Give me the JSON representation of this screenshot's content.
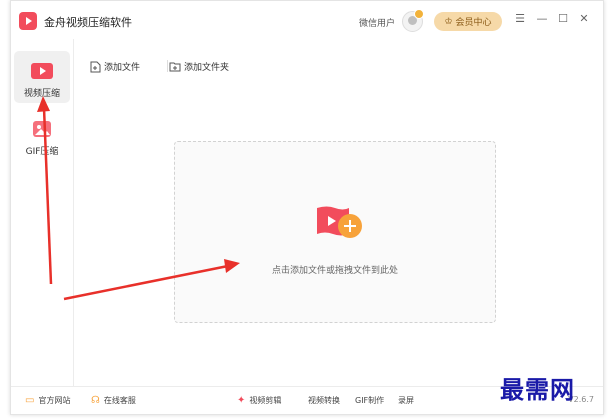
{
  "app": {
    "title": "金舟视频压缩软件"
  },
  "header": {
    "user_name": "微信用户",
    "vip_label": "会员中心"
  },
  "window_controls": {
    "menu": "☰",
    "minimize": "—",
    "maximize": "☐",
    "close": "✕"
  },
  "sidebar": {
    "items": [
      {
        "label": "视频压缩",
        "active": true
      },
      {
        "label": "GIF压缩",
        "active": false
      }
    ]
  },
  "toolbar": {
    "add_file": "添加文件",
    "add_folder": "添加文件夹"
  },
  "drop_zone": {
    "hint": "点击添加文件或拖拽文件到此处"
  },
  "footer": {
    "website": "官方网站",
    "support": "在线客服",
    "links": [
      "视频剪辑",
      "视频转换",
      "GIF制作",
      "录屏"
    ],
    "version": "V2.6.7"
  },
  "watermark": "最需网",
  "colors": {
    "accent": "#f24c5c",
    "orange": "#f7a23a",
    "annotation_arrow": "#e8302a"
  }
}
